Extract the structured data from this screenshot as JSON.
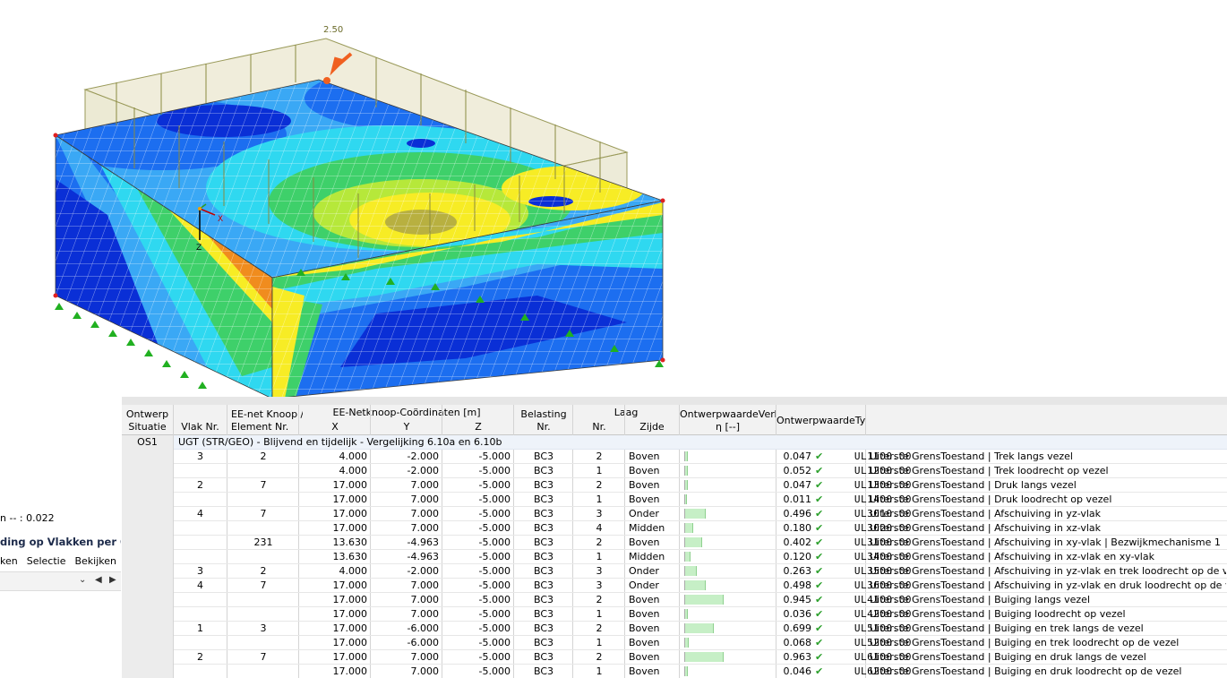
{
  "viewport": {
    "load_value": "2.50",
    "axis_x": "X",
    "axis_z": "Z",
    "colors": {
      "dark_blue": "#0a2fd6",
      "blue": "#1c6ef0",
      "light_blue": "#3aa8f5",
      "cyan": "#2fd8f0",
      "green": "#3ed06a",
      "yellow_green": "#b6e83a",
      "yellow": "#f7ec25",
      "olive": "#b8b040",
      "orange": "#f08c1e",
      "load_fill": "#e8e4c8",
      "load_stroke": "#9a9a5a",
      "support": "#21b021",
      "marker": "#f06020"
    }
  },
  "left_panel": {
    "value_text": "n -- : 0.022",
    "title": "ding op Vlakken per Ont",
    "menu": [
      "ken",
      "Selectie",
      "Bekijken"
    ]
  },
  "table": {
    "headers": {
      "situatie_top": "Ontwerp",
      "situatie_bot": "Situatie",
      "vlak_bot": "Vlak Nr.",
      "knoop_top": "EE-net Knoop /",
      "knoop_bot": "Element Nr.",
      "coord_group": "EE-Netknoop-Coördinaten [m]",
      "x": "X",
      "y": "Y",
      "z": "Z",
      "belasting_top": "Belasting",
      "belasting_bot": "Nr.",
      "laag_group": "Laag",
      "laag_nr": "Nr.",
      "zijde": "Zijde",
      "verh_top": "OntwerpwaardeVerh",
      "verh_bot": "η [--]",
      "type": "OntwerpwaardeTy"
    },
    "situation": "OS1",
    "group_label": "UGT (STR/GEO) - Blijvend en tijdelijk - Vergelijking 6.10a en 6.10b",
    "rows": [
      {
        "vlak": "3",
        "knoop": "2",
        "x": "4.000",
        "y": "-2.000",
        "z": "-5.000",
        "bel": "BC3",
        "laag": "2",
        "zijde": "Boven",
        "eta": 0.047,
        "eta_text": "0.047",
        "type": "UL1100.00",
        "desc": "Uiterste GrensToestand | Trek langs vezel"
      },
      {
        "vlak": "",
        "knoop": "",
        "x": "4.000",
        "y": "-2.000",
        "z": "-5.000",
        "bel": "BC3",
        "laag": "1",
        "zijde": "Boven",
        "eta": 0.052,
        "eta_text": "0.052",
        "type": "UL1200.00",
        "desc": "Uiterste GrensToestand | Trek loodrecht op vezel"
      },
      {
        "vlak": "2",
        "knoop": "7",
        "x": "17.000",
        "y": "7.000",
        "z": "-5.000",
        "bel": "BC3",
        "laag": "2",
        "zijde": "Boven",
        "eta": 0.047,
        "eta_text": "0.047",
        "type": "UL1300.00",
        "desc": "Uiterste GrensToestand | Druk langs vezel"
      },
      {
        "vlak": "",
        "knoop": "",
        "x": "17.000",
        "y": "7.000",
        "z": "-5.000",
        "bel": "BC3",
        "laag": "1",
        "zijde": "Boven",
        "eta": 0.011,
        "eta_text": "0.011",
        "type": "UL1400.00",
        "desc": "Uiterste GrensToestand | Druk loodrecht op vezel"
      },
      {
        "vlak": "4",
        "knoop": "7",
        "x": "17.000",
        "y": "7.000",
        "z": "-5.000",
        "bel": "BC3",
        "laag": "3",
        "zijde": "Onder",
        "eta": 0.496,
        "eta_text": "0.496",
        "type": "UL3010.00",
        "desc": "Uiterste GrensToestand | Afschuiving in yz-vlak"
      },
      {
        "vlak": "",
        "knoop": "",
        "x": "17.000",
        "y": "7.000",
        "z": "-5.000",
        "bel": "BC3",
        "laag": "4",
        "zijde": "Midden",
        "eta": 0.18,
        "eta_text": "0.180",
        "type": "UL3020.00",
        "desc": "Uiterste GrensToestand | Afschuiving in xz-vlak"
      },
      {
        "vlak": "",
        "knoop": "231",
        "x": "13.630",
        "y": "-4.963",
        "z": "-5.000",
        "bel": "BC3",
        "laag": "2",
        "zijde": "Boven",
        "eta": 0.402,
        "eta_text": "0.402",
        "type": "UL3100.00",
        "desc": "Uiterste GrensToestand | Afschuiving in xy-vlak | Bezwijkmechanisme 1"
      },
      {
        "vlak": "",
        "knoop": "",
        "x": "13.630",
        "y": "-4.963",
        "z": "-5.000",
        "bel": "BC3",
        "laag": "1",
        "zijde": "Midden",
        "eta": 0.12,
        "eta_text": "0.120",
        "type": "UL3400.00",
        "desc": "Uiterste GrensToestand | Afschuiving in xz-vlak en xy-vlak"
      },
      {
        "vlak": "3",
        "knoop": "2",
        "x": "4.000",
        "y": "-2.000",
        "z": "-5.000",
        "bel": "BC3",
        "laag": "3",
        "zijde": "Onder",
        "eta": 0.263,
        "eta_text": "0.263",
        "type": "UL3500.00",
        "desc": "Uiterste GrensToestand | Afschuiving in yz-vlak en trek loodrecht op de vezel"
      },
      {
        "vlak": "4",
        "knoop": "7",
        "x": "17.000",
        "y": "7.000",
        "z": "-5.000",
        "bel": "BC3",
        "laag": "3",
        "zijde": "Onder",
        "eta": 0.498,
        "eta_text": "0.498",
        "type": "UL3600.00",
        "desc": "Uiterste GrensToestand | Afschuiving in yz-vlak en druk loodrecht op de vezel"
      },
      {
        "vlak": "",
        "knoop": "",
        "x": "17.000",
        "y": "7.000",
        "z": "-5.000",
        "bel": "BC3",
        "laag": "2",
        "zijde": "Boven",
        "eta": 0.945,
        "eta_text": "0.945",
        "type": "UL4100.00",
        "desc": "Uiterste GrensToestand | Buiging langs vezel"
      },
      {
        "vlak": "",
        "knoop": "",
        "x": "17.000",
        "y": "7.000",
        "z": "-5.000",
        "bel": "BC3",
        "laag": "1",
        "zijde": "Boven",
        "eta": 0.036,
        "eta_text": "0.036",
        "type": "UL4200.00",
        "desc": "Uiterste GrensToestand | Buiging loodrecht op vezel"
      },
      {
        "vlak": "1",
        "knoop": "3",
        "x": "17.000",
        "y": "-6.000",
        "z": "-5.000",
        "bel": "BC3",
        "laag": "2",
        "zijde": "Boven",
        "eta": 0.699,
        "eta_text": "0.699",
        "type": "UL5100.00",
        "desc": "Uiterste GrensToestand | Buiging en trek langs de vezel"
      },
      {
        "vlak": "",
        "knoop": "",
        "x": "17.000",
        "y": "-6.000",
        "z": "-5.000",
        "bel": "BC3",
        "laag": "1",
        "zijde": "Boven",
        "eta": 0.068,
        "eta_text": "0.068",
        "type": "UL5200.00",
        "desc": "Uiterste GrensToestand | Buiging en trek loodrecht op de vezel"
      },
      {
        "vlak": "2",
        "knoop": "7",
        "x": "17.000",
        "y": "7.000",
        "z": "-5.000",
        "bel": "BC3",
        "laag": "2",
        "zijde": "Boven",
        "eta": 0.963,
        "eta_text": "0.963",
        "type": "UL6100.00",
        "desc": "Uiterste GrensToestand | Buiging en druk langs de vezel"
      },
      {
        "vlak": "",
        "knoop": "",
        "x": "17.000",
        "y": "7.000",
        "z": "-5.000",
        "bel": "BC3",
        "laag": "1",
        "zijde": "Boven",
        "eta": 0.046,
        "eta_text": "0.046",
        "type": "UL6200.00",
        "desc": "Uiterste GrensToestand | Buiging en druk loodrecht op de vezel"
      }
    ]
  }
}
